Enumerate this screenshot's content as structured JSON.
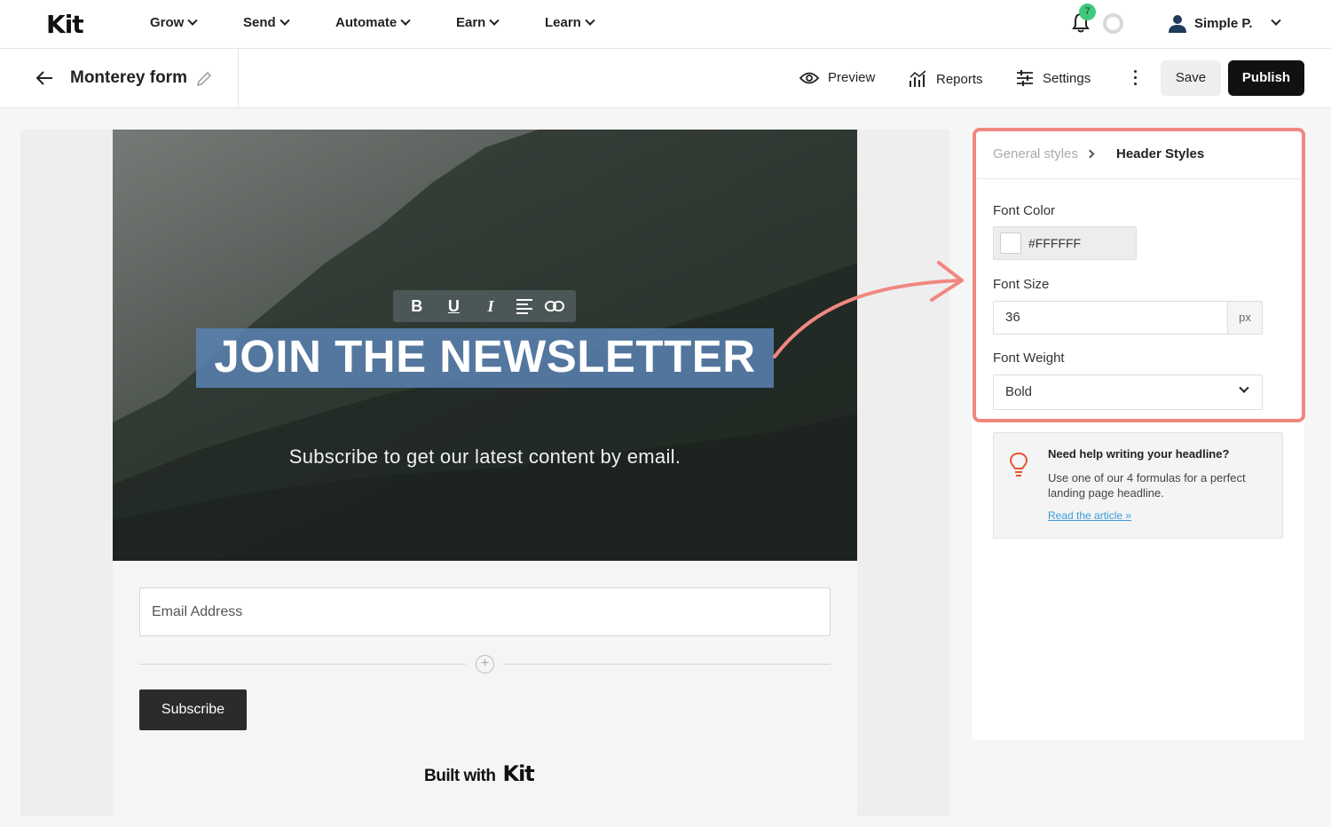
{
  "app": {
    "logo_text": "Kit"
  },
  "topnav": {
    "items": [
      {
        "label": "Grow"
      },
      {
        "label": "Send"
      },
      {
        "label": "Automate"
      },
      {
        "label": "Earn"
      },
      {
        "label": "Learn"
      }
    ],
    "notification_count": "7",
    "user_name": "Simple P."
  },
  "subbar": {
    "title": "Monterey form",
    "preview_label": "Preview",
    "reports_label": "Reports",
    "settings_label": "Settings",
    "save_label": "Save",
    "publish_label": "Publish"
  },
  "editor": {
    "toolbar": {
      "bold": "B",
      "underline": "U",
      "italic": "I"
    },
    "headline": "JOIN THE NEWSLETTER",
    "subheadline": "Subscribe to get our latest content by email.",
    "email_placeholder": "Email Address",
    "subscribe_label": "Subscribe",
    "footer_text": "Built with",
    "footer_logo": "Kit"
  },
  "panel": {
    "breadcrumb_parent": "General styles",
    "breadcrumb_current": "Header Styles",
    "font_color_label": "Font Color",
    "font_color_value": "#FFFFFF",
    "font_size_label": "Font Size",
    "font_size_value": "36",
    "font_size_unit": "px",
    "font_weight_label": "Font Weight",
    "font_weight_value": "Bold"
  },
  "help": {
    "title": "Need help writing your headline?",
    "body": "Use one of our 4 formulas for a perfect landing page headline.",
    "link": "Read the article »"
  },
  "colors": {
    "accent_highlight": "#f08880",
    "publish_bg": "#111111",
    "badge_green": "#3ec97a",
    "link_blue": "#3b9ad9",
    "selection_blue": "#5b82b3"
  }
}
